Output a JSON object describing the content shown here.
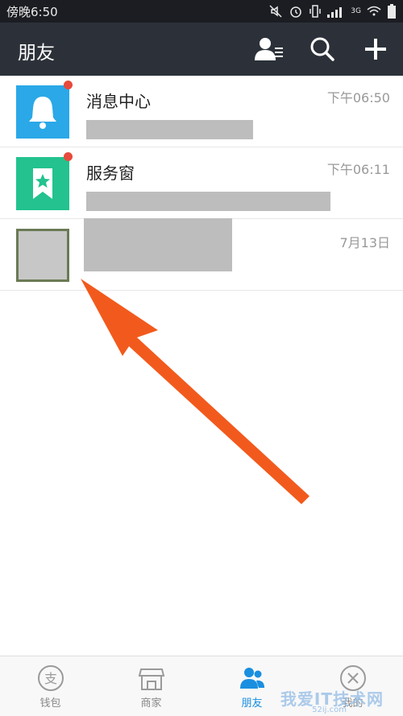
{
  "status_bar": {
    "time": "傍晚6:50",
    "network": "3G"
  },
  "header": {
    "title": "朋友"
  },
  "conversations": [
    {
      "title": "消息中心",
      "time": "下午06:50",
      "unread": true,
      "avatar_color": "#2aa8e8",
      "avatar_icon": "bell-icon"
    },
    {
      "title": "服务窗",
      "time": "下午06:11",
      "unread": true,
      "avatar_color": "#23c28f",
      "avatar_icon": "bookmark-star-icon"
    },
    {
      "title": "",
      "time": "7月13日",
      "unread": false,
      "avatar_color": "#c7c7c7",
      "avatar_icon": "user-photo"
    }
  ],
  "tabs": [
    {
      "label": "钱包",
      "icon": "alipay-icon",
      "active": false
    },
    {
      "label": "商家",
      "icon": "shop-icon",
      "active": false
    },
    {
      "label": "朋友",
      "icon": "friends-icon",
      "active": true
    },
    {
      "label": "我的",
      "icon": "profile-icon",
      "active": false
    }
  ],
  "watermark": {
    "text": "我爱IT技术网",
    "url": "52ij.com"
  },
  "colors": {
    "header_bg": "#2c3139",
    "status_bg": "#1b1d22",
    "accent": "#1a8fe0",
    "badge": "#e84a3c",
    "arrow": "#f25a1d"
  }
}
